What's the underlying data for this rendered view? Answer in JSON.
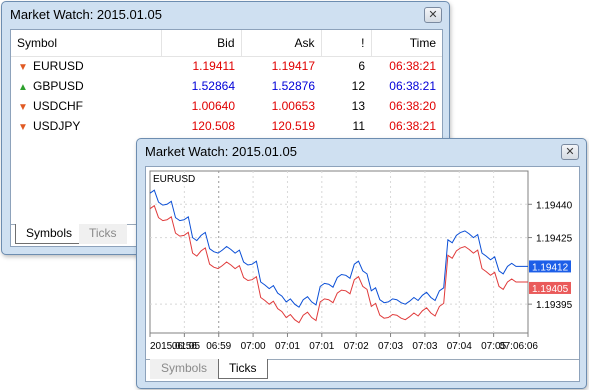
{
  "window_main": {
    "title": "Market Watch: 2015.01.05",
    "close_glyph": "✕",
    "columns": [
      "Symbol",
      "Bid",
      "Ask",
      "!",
      "Time"
    ],
    "rows": [
      {
        "symbol": "EURUSD",
        "direction": "down",
        "bid": "1.19411",
        "ask": "1.19417",
        "spread": "6",
        "time": "06:38:21",
        "color": "red"
      },
      {
        "symbol": "GBPUSD",
        "direction": "up",
        "bid": "1.52864",
        "ask": "1.52876",
        "spread": "12",
        "time": "06:38:21",
        "color": "blue"
      },
      {
        "symbol": "USDCHF",
        "direction": "down",
        "bid": "1.00640",
        "ask": "1.00653",
        "spread": "13",
        "time": "06:38:20",
        "color": "red"
      },
      {
        "symbol": "USDJPY",
        "direction": "down",
        "bid": "120.508",
        "ask": "120.519",
        "spread": "11",
        "time": "06:38:21",
        "color": "red"
      }
    ],
    "tabs": {
      "symbols": "Symbols",
      "ticks": "Ticks"
    }
  },
  "window_ticks": {
    "title": "Market Watch: 2015.01.05",
    "close_glyph": "✕",
    "tabs": {
      "symbols": "Symbols",
      "ticks": "Ticks"
    }
  },
  "colors": {
    "ask_line": "#0b4fd6",
    "bid_line": "#e03b3b",
    "ask_badge": "#1c5ee8",
    "bid_badge": "#ea5a5a"
  },
  "chart_data": {
    "type": "line",
    "symbol_label": "EURUSD",
    "y_ticks": [
      "1.19440",
      "1.19425",
      "1.19395"
    ],
    "y_tick_values": [
      1.1944,
      1.19425,
      1.19395
    ],
    "ylim": [
      1.19382,
      1.19455
    ],
    "x_labels": [
      "2015.01.05",
      "06:56",
      "06:59",
      "07:00",
      "07:01",
      "07:01",
      "07:02",
      "07:03",
      "07:03",
      "07:04",
      "07:05",
      "07:06:06"
    ],
    "ask_badge": "1.19412",
    "bid_badge": "1.19405",
    "series": [
      {
        "values": [
          1.19445,
          1.19441,
          1.1944,
          1.19434,
          1.19433,
          1.19425,
          1.19426,
          1.1942,
          1.19418,
          1.19421,
          1.19418,
          1.19414,
          1.19413,
          1.19405,
          1.19402,
          1.194,
          1.19396,
          1.19395,
          1.19397,
          1.19396,
          1.19403,
          1.19404,
          1.19407,
          1.19408,
          1.19413,
          1.1941,
          1.19401,
          1.19397,
          1.19396,
          1.19397,
          1.19395,
          1.19398,
          1.19399,
          1.19398,
          1.19401,
          1.19424,
          1.19426,
          1.19428,
          1.19425,
          1.19418,
          1.19415,
          1.1941,
          1.19412,
          1.19412
        ]
      },
      {
        "values": [
          1.19438,
          1.19434,
          1.19433,
          1.19427,
          1.19426,
          1.19418,
          1.19419,
          1.19413,
          1.19411,
          1.19414,
          1.19411,
          1.19407,
          1.19406,
          1.19398,
          1.19395,
          1.19393,
          1.19389,
          1.19388,
          1.1939,
          1.19389,
          1.19396,
          1.19397,
          1.194,
          1.19401,
          1.19406,
          1.19403,
          1.19394,
          1.1939,
          1.19389,
          1.1939,
          1.19388,
          1.19391,
          1.19392,
          1.19391,
          1.19394,
          1.19417,
          1.19419,
          1.19421,
          1.19418,
          1.19411,
          1.19408,
          1.19403,
          1.19405,
          1.19405
        ]
      }
    ]
  }
}
